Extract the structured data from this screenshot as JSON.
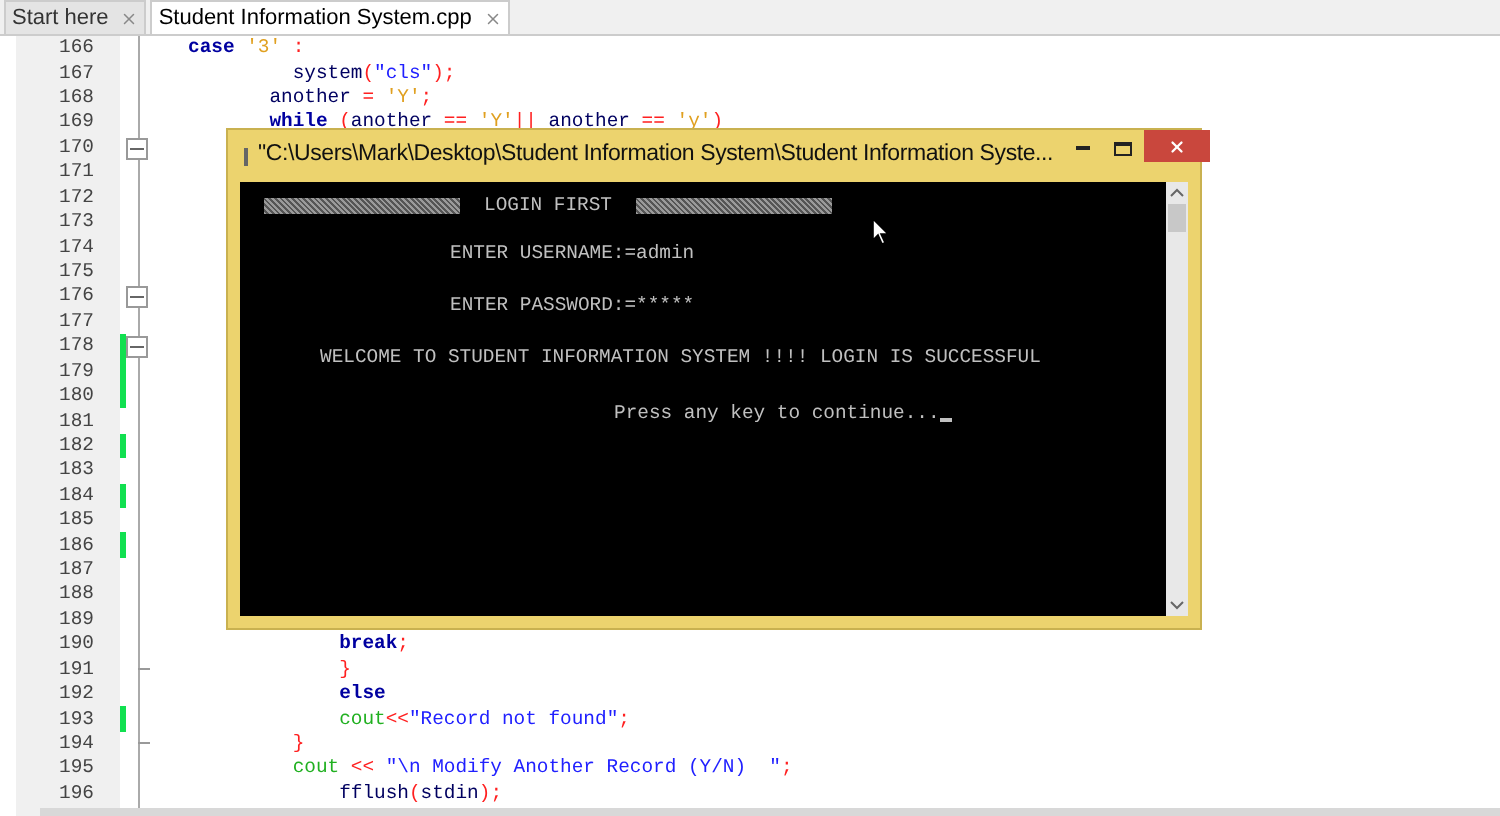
{
  "tabs": [
    {
      "label": "Start here",
      "selected": false
    },
    {
      "label": "Student Information System.cpp",
      "selected": true
    }
  ],
  "editor": {
    "lines": [
      {
        "number": "166",
        "changed": false,
        "fold_start": false,
        "fold_end": false,
        "tokens": [
          {
            "text": "case ",
            "kind": "keyword"
          },
          {
            "text": "'3'",
            "kind": "char"
          },
          {
            "text": " :",
            "kind": "op"
          }
        ]
      },
      {
        "number": "167",
        "changed": false,
        "fold_start": false,
        "fold_end": false,
        "tokens": [
          {
            "text": "         system",
            "kind": "plain"
          },
          {
            "text": "(",
            "kind": "op"
          },
          {
            "text": "\"cls\"",
            "kind": "string"
          },
          {
            "text": ");",
            "kind": "op"
          }
        ]
      },
      {
        "number": "168",
        "changed": false,
        "fold_start": false,
        "fold_end": false,
        "tokens": [
          {
            "text": "       another",
            "kind": "plain"
          },
          {
            "text": " = ",
            "kind": "op"
          },
          {
            "text": "'Y'",
            "kind": "char"
          },
          {
            "text": ";",
            "kind": "op"
          }
        ]
      },
      {
        "number": "169",
        "changed": false,
        "fold_start": false,
        "fold_end": false,
        "tokens": [
          {
            "text": "       while ",
            "kind": "keyword"
          },
          {
            "text": "(",
            "kind": "op"
          },
          {
            "text": "another ",
            "kind": "plain"
          },
          {
            "text": "== ",
            "kind": "op"
          },
          {
            "text": "'Y'",
            "kind": "char"
          },
          {
            "text": "||",
            "kind": "op"
          },
          {
            "text": " another ",
            "kind": "plain"
          },
          {
            "text": "== ",
            "kind": "op"
          },
          {
            "text": "'y'",
            "kind": "char"
          },
          {
            "text": ")",
            "kind": "op"
          }
        ]
      },
      {
        "number": "170",
        "changed": false,
        "fold_start": true,
        "fold_end": false
      },
      {
        "number": "171",
        "changed": false,
        "fold_start": false,
        "fold_end": false
      },
      {
        "number": "172",
        "changed": false,
        "fold_start": false,
        "fold_end": false
      },
      {
        "number": "173",
        "changed": false,
        "fold_start": false,
        "fold_end": false
      },
      {
        "number": "174",
        "changed": false,
        "fold_start": false,
        "fold_end": false
      },
      {
        "number": "175",
        "changed": false,
        "fold_start": false,
        "fold_end": false
      },
      {
        "number": "176",
        "changed": false,
        "fold_start": true,
        "fold_end": false
      },
      {
        "number": "177",
        "changed": false,
        "fold_start": false,
        "fold_end": false
      },
      {
        "number": "178",
        "changed": true,
        "fold_start": true,
        "fold_end": false
      },
      {
        "number": "179",
        "changed": true,
        "fold_start": false,
        "fold_end": false
      },
      {
        "number": "180",
        "changed": true,
        "fold_start": false,
        "fold_end": false
      },
      {
        "number": "181",
        "changed": false,
        "fold_start": false,
        "fold_end": false
      },
      {
        "number": "182",
        "changed": true,
        "fold_start": false,
        "fold_end": false
      },
      {
        "number": "183",
        "changed": false,
        "fold_start": false,
        "fold_end": false
      },
      {
        "number": "184",
        "changed": true,
        "fold_start": false,
        "fold_end": false
      },
      {
        "number": "185",
        "changed": false,
        "fold_start": false,
        "fold_end": false
      },
      {
        "number": "186",
        "changed": true,
        "fold_start": false,
        "fold_end": false
      },
      {
        "number": "187",
        "changed": false,
        "fold_start": false,
        "fold_end": false
      },
      {
        "number": "188",
        "changed": false,
        "fold_start": false,
        "fold_end": false
      },
      {
        "number": "189",
        "changed": false,
        "fold_start": false,
        "fold_end": false
      },
      {
        "number": "190",
        "changed": false,
        "fold_start": false,
        "fold_end": false,
        "tokens": [
          {
            "text": "             break",
            "kind": "keyword"
          },
          {
            "text": ";",
            "kind": "op"
          }
        ]
      },
      {
        "number": "191",
        "changed": false,
        "fold_start": false,
        "fold_end": true,
        "tokens": [
          {
            "text": "             }",
            "kind": "op"
          }
        ]
      },
      {
        "number": "192",
        "changed": false,
        "fold_start": false,
        "fold_end": false,
        "tokens": [
          {
            "text": "             else",
            "kind": "keyword"
          }
        ]
      },
      {
        "number": "193",
        "changed": true,
        "fold_start": false,
        "fold_end": false,
        "tokens": [
          {
            "text": "             cout",
            "kind": "stream"
          },
          {
            "text": "<<",
            "kind": "op"
          },
          {
            "text": "\"Record not found\"",
            "kind": "string"
          },
          {
            "text": ";",
            "kind": "op"
          }
        ]
      },
      {
        "number": "194",
        "changed": false,
        "fold_start": false,
        "fold_end": true,
        "tokens": [
          {
            "text": "         }",
            "kind": "op"
          }
        ]
      },
      {
        "number": "195",
        "changed": false,
        "fold_start": false,
        "fold_end": false,
        "tokens": [
          {
            "text": "         cout",
            "kind": "stream"
          },
          {
            "text": " << ",
            "kind": "op"
          },
          {
            "text": "\"\\n Modify Another Record (Y/N)  \"",
            "kind": "string"
          },
          {
            "text": ";",
            "kind": "op"
          }
        ]
      },
      {
        "number": "196",
        "changed": false,
        "fold_start": false,
        "fold_end": false,
        "tokens": [
          {
            "text": "             fflush",
            "kind": "plain"
          },
          {
            "text": "(",
            "kind": "op"
          },
          {
            "text": "stdin",
            "kind": "plain"
          },
          {
            "text": ")",
            "kind": "op"
          },
          {
            "text": ";",
            "kind": "op"
          }
        ]
      }
    ]
  },
  "console": {
    "title": "\"C:\\Users\\Mark\\Desktop\\Student Information System\\Student Information Syste...",
    "heading": "LOGIN FIRST",
    "lines": [
      {
        "text": "ENTER USERNAME:=admin"
      },
      {
        "text": "ENTER PASSWORD:=*****"
      },
      {
        "text": "WELCOME TO STUDENT INFORMATION SYSTEM !!!! LOGIN IS SUCCESSFUL"
      },
      {
        "text": "Press any key to continue..."
      }
    ]
  }
}
